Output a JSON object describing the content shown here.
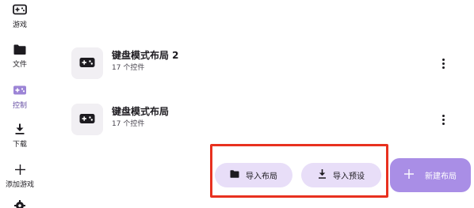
{
  "nav": {
    "items": [
      {
        "label": "游戏",
        "icon": "gamepad-icon"
      },
      {
        "label": "文件",
        "icon": "folder-icon"
      },
      {
        "label": "控制",
        "icon": "gamepad-icon",
        "active": true
      },
      {
        "label": "下载",
        "icon": "download-icon"
      },
      {
        "label": "添加游戏",
        "icon": "plus-icon"
      },
      {
        "label": "",
        "icon": "settings-icon"
      }
    ]
  },
  "layouts": [
    {
      "title": "键盘模式布局 2",
      "subtitle": "17 个控件"
    },
    {
      "title": "键盘模式布局",
      "subtitle": "17 个控件"
    }
  ],
  "actions": {
    "import_layout": "导入布局",
    "import_preset": "导入预设",
    "new_layout": "新建布局"
  },
  "colors": {
    "accent": "#6750a4",
    "tonal_button": "#e8def8",
    "fab": "#a98ee6",
    "highlight": "#e8311f"
  }
}
